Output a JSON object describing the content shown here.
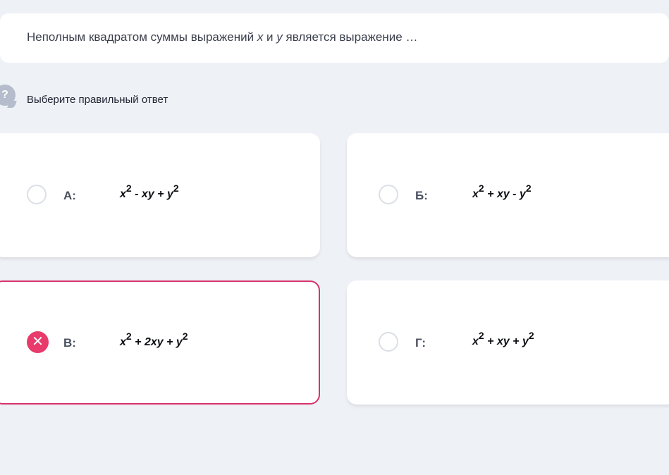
{
  "question": {
    "text_before": "Неполным квадратом суммы выражений ",
    "var_x": "x",
    "text_and": " и ",
    "var_y": "y",
    "text_after": " является выражение …"
  },
  "hint": {
    "icon_glyph": "?",
    "instruction": "Выберите правильный ответ"
  },
  "options": [
    {
      "label": "А:",
      "state": "unselected",
      "formula": [
        "x",
        "2",
        " - xy + y",
        "2"
      ]
    },
    {
      "label": "Б:",
      "state": "unselected",
      "formula": [
        "x",
        "2",
        " + xy - y",
        "2"
      ]
    },
    {
      "label": "В:",
      "state": "wrong",
      "formula": [
        "x",
        "2",
        " + 2xy + y",
        "2"
      ]
    },
    {
      "label": "Г:",
      "state": "unselected",
      "formula": [
        "x",
        "2",
        " + xy + y",
        "2"
      ]
    }
  ],
  "colors": {
    "background": "#eef1f6",
    "wrong_accent": "#e83a6b",
    "wrong_border": "#d6336c",
    "hint_icon": "#b5bccb"
  },
  "icons": {
    "wrong_mark": "✕"
  }
}
